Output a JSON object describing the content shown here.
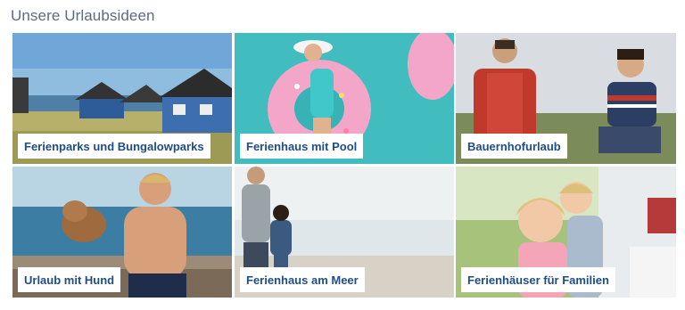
{
  "section": {
    "title": "Unsere Urlaubsideen"
  },
  "tiles": [
    {
      "label": "Ferienparks und Bungalowparks",
      "image": "houses-by-the-sea"
    },
    {
      "label": "Ferienhaus mit Pool",
      "image": "woman-on-pool-float"
    },
    {
      "label": "Bauernhofurlaub",
      "image": "father-and-son-on-farm"
    },
    {
      "label": "Urlaub mit Hund",
      "image": "boy-with-dog-at-sea"
    },
    {
      "label": "Ferienhaus am Meer",
      "image": "father-and-child-at-beach"
    },
    {
      "label": "Ferienhäuser für Familien",
      "image": "children-in-garden"
    }
  ]
}
